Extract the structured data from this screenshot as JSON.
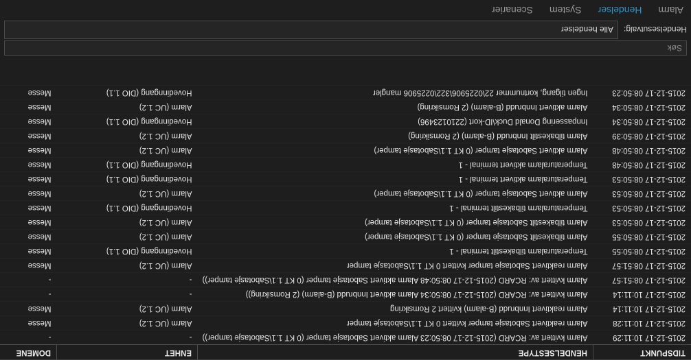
{
  "tabs": [
    {
      "label": "Alarm",
      "active": false
    },
    {
      "label": "Hendelser",
      "active": true
    },
    {
      "label": "System",
      "active": false
    },
    {
      "label": "Scenarier",
      "active": false
    }
  ],
  "filter": {
    "label": "Hendelsesutvalg:",
    "selected": "Alle hendelser"
  },
  "search": {
    "placeholder": "Søk",
    "value": ""
  },
  "table": {
    "columns": [
      "TIDSPUNKT",
      "HENDELSESTYPE",
      "ENHET",
      "DOMENE"
    ],
    "rows": [
      {
        "time": "2015-12-17 10:11:29",
        "type": "Alarm kvittert av: RCARD (2015-12-17 08:50:23 Alarm aktivert Sabotasje tamper (0 KT 1.1\\Sabotasje tamper))",
        "unit": "-",
        "domain": "-"
      },
      {
        "time": "2015-12-17 10:11:28",
        "type": "Alarm reaktivert Sabotasje tamper kvittert 0 KT 1.1\\Sabotasje tamper",
        "unit": "Alarm (UC 1.2)",
        "domain": "Messe"
      },
      {
        "time": "2015-12-17 10:11:14",
        "type": "Alarm reaktivert Innbrudd (B-alarm) kvittert 2 Romsikring",
        "unit": "Alarm (UC 1.2)",
        "domain": "Messe"
      },
      {
        "time": "2015-12-17 10:11:14",
        "type": "Alarm kvittert av: RCARD (2015-12-17 08:50:34 Alarm aktivert Innbrudd (B-alarm) (2 Romsikring))",
        "unit": "-",
        "domain": "-"
      },
      {
        "time": "2015-12-17 08:51:57",
        "type": "Alarm kvittert av: RCARD (2015-12-17 08:50:48 Alarm aktivert Sabotasje tamper (0 KT 1.1\\Sabotasje tamper))",
        "unit": "-",
        "domain": "-"
      },
      {
        "time": "2015-12-17 08:51:57",
        "type": "Alarm reaktivert Sabotasje tamper kvittert 0 KT 1.1\\Sabotasje tamper",
        "unit": "Alarm (UC 1.2)",
        "domain": "Messe"
      },
      {
        "time": "2015-12-17 08:50:55",
        "type": "Temperaturalarm tilbakestilt terminal - 1",
        "unit": "Hovedinngang (DIO 1.1)",
        "domain": "Messe"
      },
      {
        "time": "2015-12-17 08:50:55",
        "type": "Alarm tilbakestilt Sabotasje tamper (0 KT 1.1\\Sabotasje tamper)",
        "unit": "Alarm (UC 1.2)",
        "domain": "Messe"
      },
      {
        "time": "2015-12-17 08:50:53",
        "type": "Alarm tilbakestilt Sabotasje tamper (0 KT 1.1\\Sabotasje tamper)",
        "unit": "Alarm (UC 1.2)",
        "domain": "Messe"
      },
      {
        "time": "2015-12-17 08:50:53",
        "type": "Temperaturalarm tilbakestilt terminal - 1",
        "unit": "Hovedinngang (DIO 1.1)",
        "domain": "Messe"
      },
      {
        "time": "2015-12-17 08:50:53",
        "type": "Alarm aktivert Sabotasje tamper (0 KT 1.1\\Sabotasje tamper)",
        "unit": "Alarm (UC 1.2)",
        "domain": "Messe"
      },
      {
        "time": "2015-12-17 08:50:53",
        "type": "Temperaturalarm aktivert terminal - 1",
        "unit": "Hovedinngang (DIO 1.1)",
        "domain": "Messe"
      },
      {
        "time": "2015-12-17 08:50:48",
        "type": "Temperaturalarm aktivert terminal - 1",
        "unit": "Hovedinngang (DIO 1.1)",
        "domain": "Messe"
      },
      {
        "time": "2015-12-17 08:50:48",
        "type": "Alarm aktivert Sabotasje tamper (0 KT 1.1\\Sabotasje tamper)",
        "unit": "Alarm (UC 1.2)",
        "domain": "Messe"
      },
      {
        "time": "2015-12-17 08:50:39",
        "type": "Alarm tilbakestilt Innbrudd (B-alarm) (2 Romsikring)",
        "unit": "Alarm (UC 1.2)",
        "domain": "Messe"
      },
      {
        "time": "2015-12-17 08:50:34",
        "type": "Innpassering Donald Duck\\ID-kort (2210123496)",
        "unit": "Hovedinngang (DIO 1.1)",
        "domain": "Messe"
      },
      {
        "time": "2015-12-17 08:50:34",
        "type": "Alarm aktivert Innbrudd (B-alarm) (2 Romsikring)",
        "unit": "Alarm (UC 1.2)",
        "domain": "Messe"
      },
      {
        "time": "2015-12-17 08:50:23",
        "type": "Ingen tilgang, kortnummer 22\\0225906\\322\\0225906 mangler",
        "unit": "Hovedinngang (DIO 1.1)",
        "domain": "Messe"
      }
    ]
  },
  "colors": {
    "accent": "#2f94c6",
    "background": "#1e1e1e",
    "field": "#252525",
    "border": "#4a4a4a",
    "text": "#e2e2e2",
    "muted": "#9a9a9a"
  }
}
